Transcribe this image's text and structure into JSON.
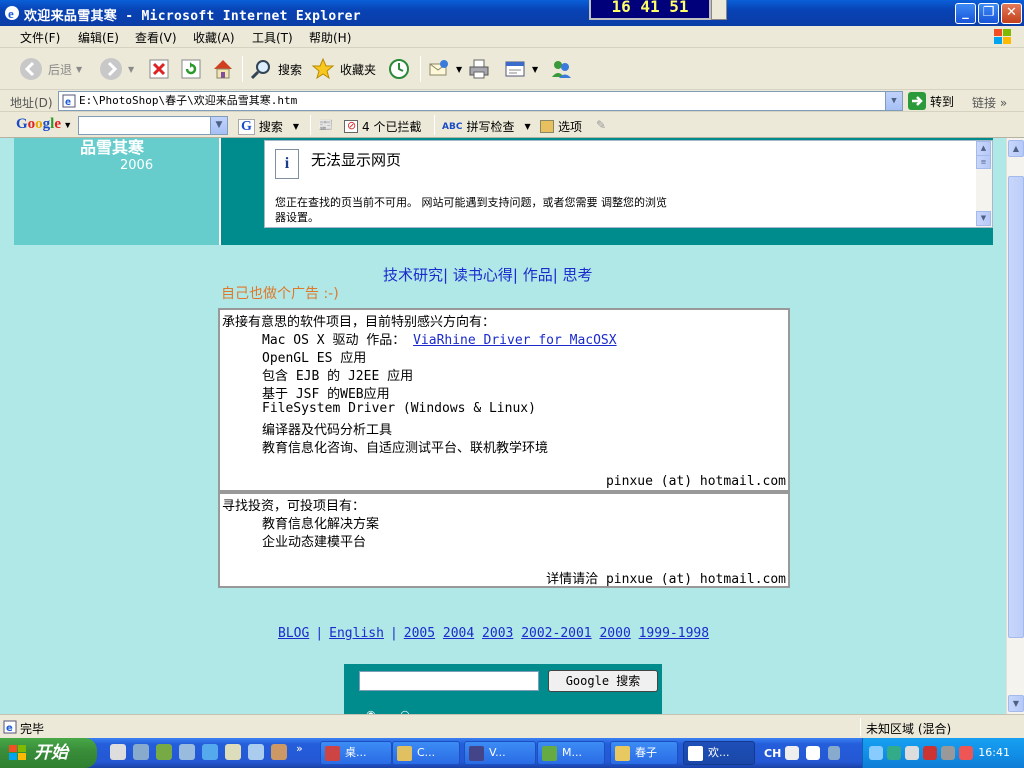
{
  "window": {
    "title": "欢迎来品雪其寒 - Microsoft Internet Explorer",
    "overlay_clock": "16 41 51"
  },
  "menu": [
    "文件(F)",
    "编辑(E)",
    "查看(V)",
    "收藏(A)",
    "工具(T)",
    "帮助(H)"
  ],
  "toolbar": {
    "back_label": "后退",
    "search_label": "搜索",
    "favorites_label": "收藏夹"
  },
  "address": {
    "label": "地址(D)",
    "value": "E:\\PhotoShop\\春子\\欢迎来品雪其寒.htm",
    "go_label": "转到",
    "links_label": "链接"
  },
  "google_toolbar": {
    "logo": "Google",
    "search_label": "搜索",
    "blocked_label": "4 个已拦截",
    "spellcheck_label": "拼写检查",
    "options_label": "选项"
  },
  "header": {
    "site_title": "品雪其寒",
    "year": "2006"
  },
  "iframe_error": {
    "title": "无法显示网页",
    "text": "您正在查找的页当前不可用。 网站可能遇到支持问题，或者您需要 调整您的浏览器设置。"
  },
  "nav_links": [
    "技术研究",
    "读书心得",
    "作品",
    "思考"
  ],
  "ad_line": "自己也做个广告 :-)",
  "projects_box": {
    "heading": "承接有意思的软件项目，目前特别感兴方向有：",
    "item1_prefix": "Mac OS X 驱动   作品： ",
    "item1_link": "ViaRhine Driver for MacOSX",
    "items": [
      "OpenGL ES 应用",
      "包含 EJB 的 J2EE 应用",
      "基于 JSF 的WEB应用",
      "FileSystem Driver (Windows & Linux)",
      "编译器及代码分析工具",
      "教育信息化咨询、自适应测试平台、联机教学环境"
    ],
    "contact": "pinxue (at) hotmail.com"
  },
  "invest_box": {
    "heading": "寻找投资，可投项目有：",
    "items": [
      "教育信息化解决方案",
      "企业动态建模平台"
    ],
    "contact": "详情请洽 pinxue (at) hotmail.com"
  },
  "year_links": {
    "blog": "BLOG",
    "english": "English",
    "years": [
      "2005",
      "2004",
      "2003",
      "2002-2001",
      "2000",
      "1999-1998"
    ]
  },
  "google_search_panel": {
    "button_label": "Google 搜索"
  },
  "status": {
    "text": "完毕",
    "zone": "未知区域 (混合)"
  },
  "taskbar": {
    "start_label": "开始",
    "tasks": [
      "桌...",
      "C...",
      "V...",
      "M...",
      "春子",
      "欢..."
    ],
    "lang": "CH",
    "clock": "16:41"
  }
}
